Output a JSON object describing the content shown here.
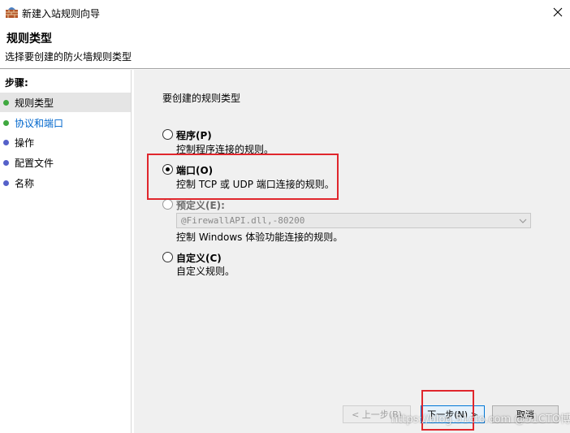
{
  "window": {
    "title": "新建入站规则向导",
    "icon": "firewall-app-icon",
    "close_icon": "close-icon"
  },
  "header": {
    "title": "规则类型",
    "subtitle": "选择要创建的防火墙规则类型"
  },
  "sidebar": {
    "label": "步骤:",
    "items": [
      {
        "label": "规则类型",
        "color": "#3fa83f",
        "selected": true
      },
      {
        "label": "协议和端口",
        "color": "#3fa83f",
        "selected": false
      },
      {
        "label": "操作",
        "color": "#5561c9",
        "selected": false
      },
      {
        "label": "配置文件",
        "color": "#5561c9",
        "selected": false
      },
      {
        "label": "名称",
        "color": "#5561c9",
        "selected": false
      }
    ]
  },
  "main": {
    "prompt": "要创建的规则类型",
    "options": [
      {
        "title": "程序(P)",
        "desc": "控制程序连接的规则。",
        "checked": false
      },
      {
        "title": "端口(O)",
        "desc": "控制 TCP 或 UDP 端口连接的规则。",
        "checked": true
      },
      {
        "title": "预定义(E):",
        "desc": "控制 Windows 体验功能连接的规则。",
        "checked": false,
        "disabled": true,
        "dropdown_value": "@FirewallAPI.dll,-80200"
      },
      {
        "title": "自定义(C)",
        "desc": "自定义规则。",
        "checked": false
      }
    ]
  },
  "buttons": {
    "back": "< 上一步(B)",
    "next": "下一步(N) >",
    "cancel": "取消"
  },
  "watermark": "https://blog.51cto.com @51CTO博客",
  "colors": {
    "highlight": "#e0262c",
    "accent": "#0078d7"
  }
}
